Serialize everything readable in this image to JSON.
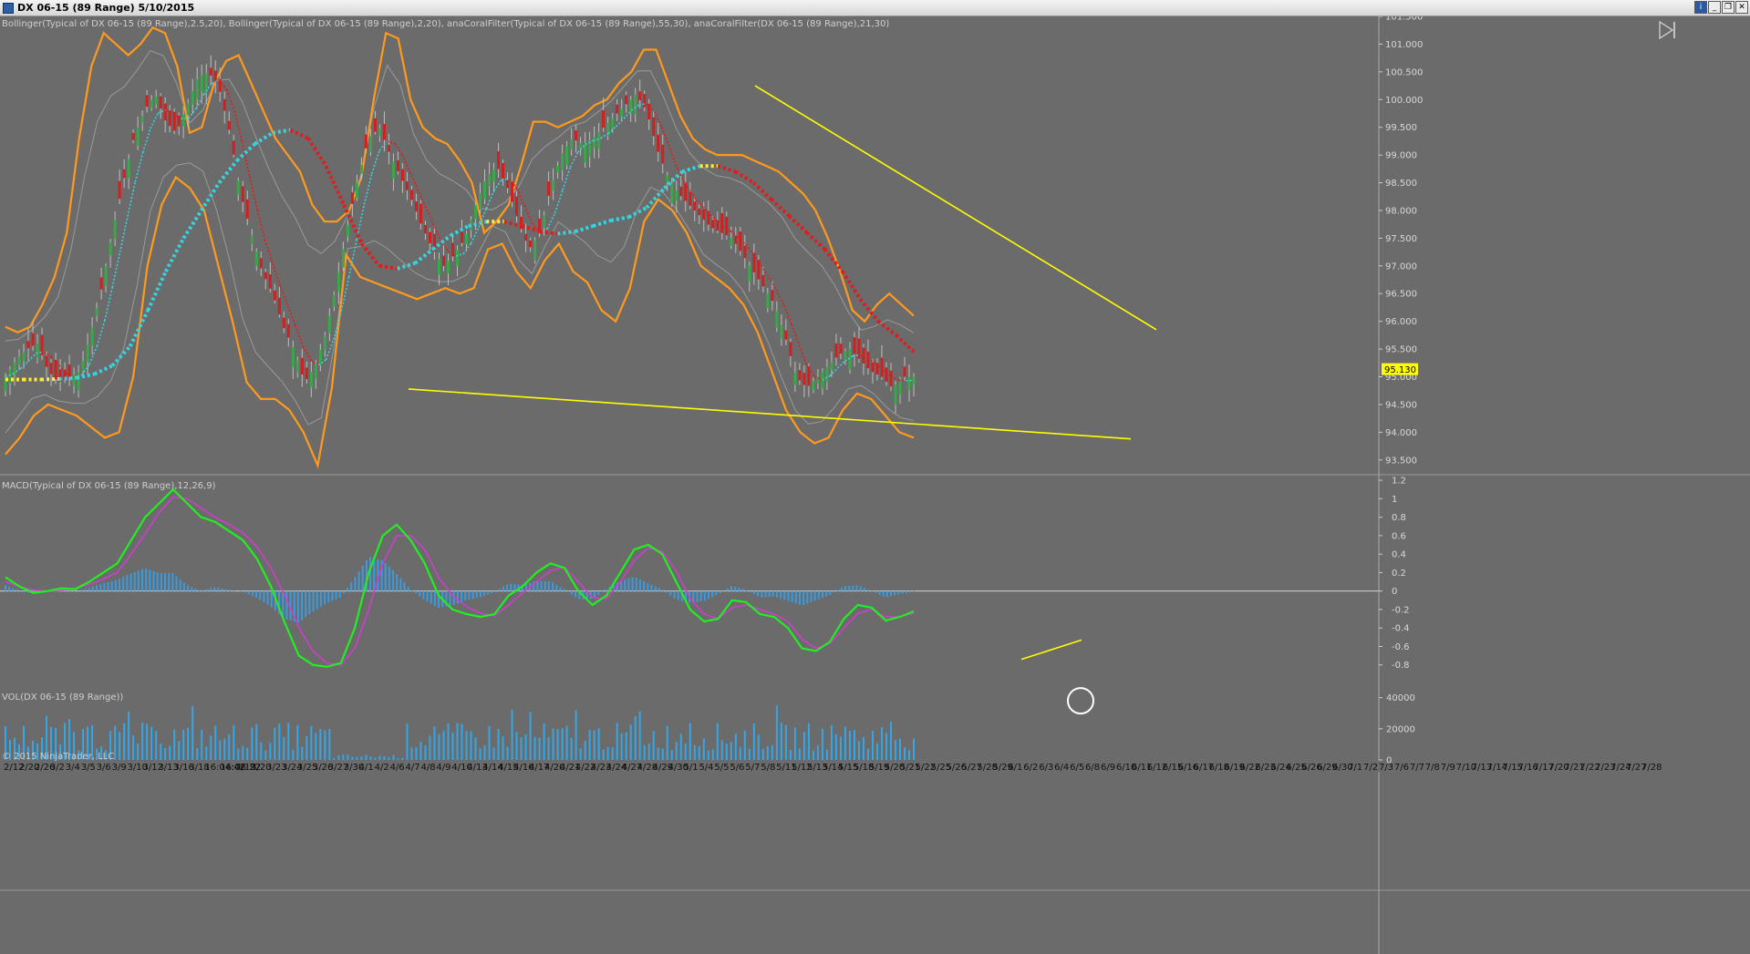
{
  "window": {
    "title": "DX 06-15 (89 Range)  5/10/2015",
    "controls": [
      "i",
      "_",
      "❐",
      "✕"
    ]
  },
  "colors": {
    "background": "#6b6b6b",
    "bollinger_outer": "#ff9a1f",
    "bollinger_inner": "#9a9a9a",
    "coral_fast": "#37d3e0",
    "coral_slow_up": "#ffeb3b",
    "coral_slow_down": "#e01c1c",
    "trendline": "#ffff00",
    "candle_up": "#3aa84a",
    "candle_down": "#d02020",
    "macd_line": "#22ee22",
    "macd_signal": "#d23cd2",
    "histogram": "#3a9be0",
    "volume": "#35a6e6",
    "price_tag": "#ffff00"
  },
  "icons": {
    "play_to_end": "skip-to-end-icon"
  },
  "watermark": "© 2015 NinjaTrader, LLC",
  "chart_data": [
    {
      "type": "line",
      "pane": "price",
      "label": "Bollinger(Typical of DX 06-15 (89 Range),2.5,20), Bollinger(Typical of DX 06-15 (89 Range),2,20), anaCoralFilter(Typical of DX 06-15 (89 Range),55,30), anaCoralFilter(DX 06-15 (89 Range),21,30)",
      "ylim": [
        93.25,
        101.5
      ],
      "y_ticks": [
        "93.500",
        "94.000",
        "94.500",
        "95.000",
        "95.500",
        "96.000",
        "96.500",
        "97.000",
        "97.500",
        "98.000",
        "98.500",
        "99.000",
        "99.500",
        "100.000",
        "100.500",
        "101.000",
        "101.500"
      ],
      "y_tick_values": [
        93.5,
        94,
        94.5,
        95,
        95.5,
        96,
        96.5,
        97,
        97.5,
        98,
        98.5,
        99,
        99.5,
        100,
        100.5,
        101,
        101.5
      ],
      "bars": 200,
      "last_price": "95.130",
      "close": [
        95.0,
        95.3,
        95.5,
        95.6,
        95.1,
        94.9,
        95.0,
        95.1,
        95.8,
        96.6,
        97.6,
        98.5,
        99.3,
        99.8,
        100.1,
        99.6,
        99.4,
        99.9,
        100.4,
        100.5,
        100.2,
        99.4,
        98.3,
        97.6,
        96.9,
        96.5,
        95.9,
        95.5,
        94.9,
        95.2,
        95.8,
        96.7,
        97.7,
        98.6,
        99.3,
        99.5,
        99.0,
        98.6,
        98.2,
        97.7,
        97.3,
        97.0,
        97.2,
        97.5,
        98.1,
        98.6,
        98.8,
        98.4,
        97.8,
        97.3,
        97.6,
        98.4,
        99.0,
        99.3,
        99.2,
        99.3,
        99.5,
        99.7,
        99.9,
        100.1,
        99.8,
        99.1,
        98.6,
        98.3,
        98.1,
        97.9,
        97.7,
        97.6,
        97.5,
        97.2,
        96.9,
        96.6,
        96.3,
        95.7,
        95.0,
        94.8,
        95.0,
        95.2,
        95.4,
        95.5,
        95.3,
        95.1,
        95.0,
        94.8,
        95.0,
        95.0
      ],
      "close_x_step": 1,
      "bollinger_outer_upper": [
        95.9,
        95.8,
        95.9,
        96.3,
        96.8,
        97.6,
        99.3,
        100.6,
        101.2,
        101.0,
        100.8,
        101.0,
        101.3,
        101.2,
        100.6,
        99.4,
        99.5,
        100.3,
        100.7,
        100.8,
        100.3,
        99.8,
        99.3,
        99.0,
        98.7,
        98.1,
        97.8,
        97.8,
        98.0,
        98.6,
        100.0,
        101.2,
        101.1,
        100.0,
        99.5,
        99.3,
        99.2,
        98.9,
        98.5,
        97.6,
        97.8,
        98.1,
        98.8,
        99.6,
        99.6,
        99.5,
        99.6,
        99.7,
        99.9,
        100.0,
        100.3,
        100.5,
        100.9,
        100.9,
        100.3,
        99.7,
        99.3,
        99.1,
        99.0,
        99.0,
        99.0,
        98.9,
        98.8,
        98.7,
        98.5,
        98.3,
        98.0,
        97.5,
        96.9,
        96.2,
        96.0,
        96.3,
        96.5,
        96.3,
        96.1
      ],
      "bollinger_outer_lower": [
        93.6,
        93.9,
        94.3,
        94.5,
        94.4,
        94.3,
        94.1,
        93.9,
        94.0,
        95.0,
        97.0,
        98.1,
        98.6,
        98.4,
        98.0,
        97.0,
        96.0,
        94.9,
        94.6,
        94.6,
        94.4,
        94.0,
        93.4,
        94.8,
        97.2,
        96.8,
        96.7,
        96.6,
        96.5,
        96.4,
        96.5,
        96.6,
        96.5,
        96.6,
        97.3,
        97.4,
        96.9,
        96.6,
        97.1,
        97.4,
        96.9,
        96.7,
        96.2,
        96.0,
        96.6,
        97.8,
        98.2,
        98.0,
        97.6,
        97.0,
        96.8,
        96.6,
        96.3,
        95.8,
        95.1,
        94.4,
        94.0,
        93.8,
        93.9,
        94.4,
        94.7,
        94.6,
        94.3,
        94.0,
        93.9
      ],
      "coral_slow": [
        94.95,
        94.95,
        94.95,
        94.96,
        94.98,
        95.05,
        95.2,
        95.55,
        96.2,
        96.9,
        97.5,
        98.0,
        98.5,
        98.9,
        99.2,
        99.4,
        99.45,
        99.3,
        98.8,
        98.1,
        97.4,
        97.0,
        96.95,
        97.05,
        97.3,
        97.55,
        97.72,
        97.8,
        97.8,
        97.72,
        97.62,
        97.58,
        97.62,
        97.72,
        97.82,
        97.88,
        98.05,
        98.4,
        98.7,
        98.8,
        98.8,
        98.7,
        98.5,
        98.2,
        97.9,
        97.6,
        97.3,
        96.9,
        96.4,
        96.0,
        95.75,
        95.45
      ]
    },
    {
      "type": "line",
      "pane": "macd",
      "label": "MACD(Typical of DX 06-15 (89 Range),12,26,9)",
      "ylim": [
        -1.0,
        1.25
      ],
      "y_ticks": [
        "-0.8",
        "-0.6",
        "-0.4",
        "-0.2",
        "0",
        "0.2",
        "0.4",
        "0.6",
        "0.8",
        "1",
        "1.2"
      ],
      "y_tick_values": [
        -0.8,
        -0.6,
        -0.4,
        -0.2,
        0,
        0.2,
        0.4,
        0.6,
        0.8,
        1,
        1.2
      ],
      "macd": [
        0.15,
        0.05,
        -0.02,
        0.0,
        0.03,
        0.02,
        0.1,
        0.2,
        0.3,
        0.55,
        0.8,
        0.95,
        1.1,
        0.95,
        0.8,
        0.75,
        0.65,
        0.55,
        0.35,
        0.05,
        -0.35,
        -0.7,
        -0.8,
        -0.82,
        -0.78,
        -0.4,
        0.2,
        0.6,
        0.72,
        0.55,
        0.3,
        -0.05,
        -0.2,
        -0.25,
        -0.28,
        -0.25,
        -0.05,
        0.05,
        0.2,
        0.3,
        0.25,
        0.0,
        -0.15,
        -0.05,
        0.2,
        0.45,
        0.5,
        0.4,
        0.1,
        -0.2,
        -0.33,
        -0.3,
        -0.1,
        -0.12,
        -0.25,
        -0.28,
        -0.4,
        -0.62,
        -0.65,
        -0.55,
        -0.3,
        -0.15,
        -0.18,
        -0.32,
        -0.28,
        -0.22
      ],
      "signal": [
        0.1,
        0.05,
        0.01,
        0.0,
        0.01,
        0.03,
        0.07,
        0.13,
        0.2,
        0.4,
        0.62,
        0.85,
        1.02,
        1.0,
        0.9,
        0.8,
        0.72,
        0.63,
        0.48,
        0.25,
        -0.05,
        -0.4,
        -0.65,
        -0.78,
        -0.8,
        -0.62,
        -0.2,
        0.3,
        0.6,
        0.6,
        0.45,
        0.15,
        -0.05,
        -0.17,
        -0.24,
        -0.27,
        -0.15,
        -0.02,
        0.1,
        0.22,
        0.26,
        0.1,
        -0.07,
        -0.08,
        0.1,
        0.33,
        0.47,
        0.43,
        0.22,
        -0.08,
        -0.25,
        -0.3,
        -0.18,
        -0.15,
        -0.2,
        -0.25,
        -0.33,
        -0.52,
        -0.62,
        -0.57,
        -0.4,
        -0.24,
        -0.2,
        -0.28,
        -0.28,
        -0.24
      ]
    },
    {
      "type": "bar",
      "pane": "volume",
      "label": "VOL(DX 06-15 (89 Range))",
      "ylim": [
        0,
        48000
      ],
      "y_ticks": [
        "0",
        "20000",
        "40000"
      ],
      "y_tick_values": [
        0,
        20000,
        40000
      ],
      "highlight_spike": 40000
    }
  ],
  "x_axis": {
    "labels": [
      "2/12",
      "2/20",
      "2/26",
      "3/2",
      "3/4",
      "3/5",
      "3/6",
      "3/9",
      "3/10",
      "3/12",
      "3/13",
      "3/16",
      "3/18",
      "16:04:42",
      "16:06:22",
      "3/19",
      "3/20",
      "3/23",
      "3/24",
      "3/25",
      "3/26",
      "3/27",
      "3/30",
      "4/1",
      "4/2",
      "4/6",
      "4/7",
      "4/8",
      "4/9",
      "4/10",
      "4/13",
      "4/14",
      "4/15",
      "4/16",
      "4/17",
      "4/20",
      "4/21",
      "4/22",
      "4/23",
      "4/24",
      "4/27",
      "4/28",
      "4/29",
      "4/30",
      "5/1",
      "5/4",
      "5/5",
      "5/6",
      "5/7",
      "5/8",
      "5/11",
      "5/12",
      "5/13",
      "5/14",
      "5/15",
      "5/18",
      "5/19",
      "5/20",
      "5/21",
      "5/22",
      "5/25",
      "5/26",
      "5/27",
      "5/28",
      "5/29",
      "6/1",
      "6/2",
      "6/3",
      "6/4",
      "6/5",
      "6/8",
      "6/9",
      "6/10",
      "6/11",
      "6/12",
      "6/15",
      "6/16",
      "6/17",
      "6/18",
      "6/19",
      "6/22",
      "6/23",
      "6/24",
      "6/25",
      "6/26",
      "6/29",
      "6/30",
      "7/1",
      "7/2",
      "7/3",
      "7/6",
      "7/7",
      "7/8",
      "7/9",
      "7/10",
      "7/13",
      "7/14",
      "7/15",
      "7/16",
      "7/17",
      "7/20",
      "7/21",
      "7/22",
      "7/23",
      "7/24",
      "7/27",
      "7/28"
    ]
  }
}
